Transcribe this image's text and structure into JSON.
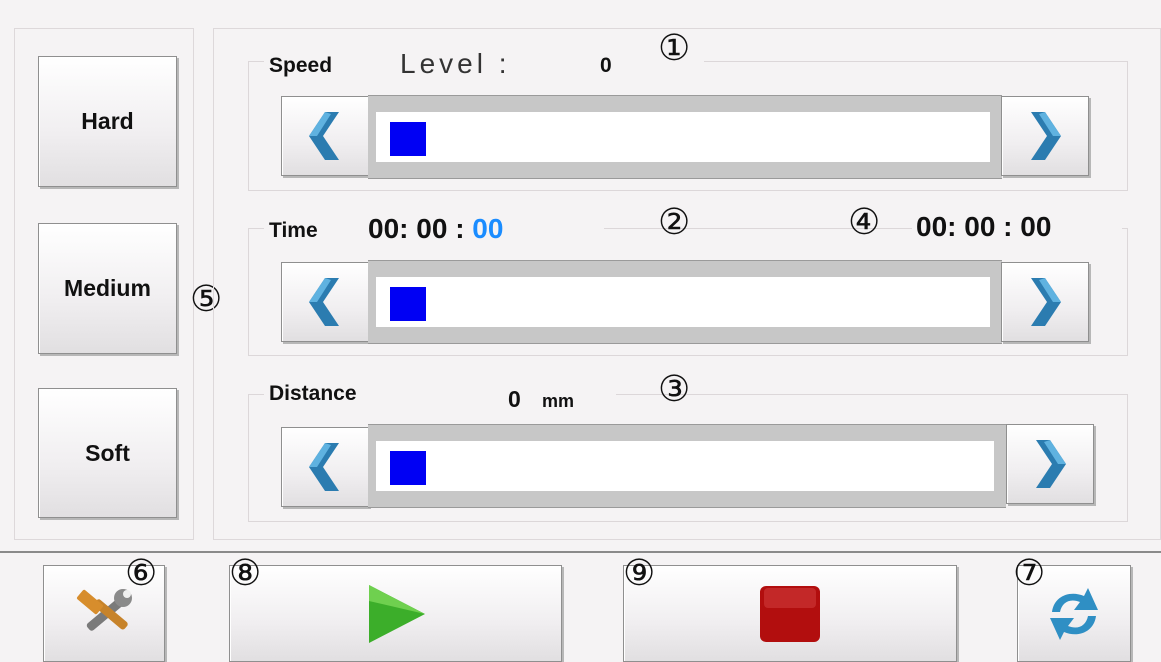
{
  "modes": {
    "hard": "Hard",
    "medium": "Medium",
    "soft": "Soft"
  },
  "speed": {
    "label": "Speed",
    "level_label": "Level :",
    "level_value": "0",
    "marker": "①",
    "fill_fraction": 0
  },
  "time": {
    "label": "Time",
    "hours": "00:",
    "minutes": "00",
    "sep": ":",
    "seconds": "00",
    "marker": "②",
    "total_marker": "④",
    "total": "00: 00 : 00",
    "fill_fraction": 0
  },
  "distance": {
    "label": "Distance",
    "value": "0",
    "unit": "mm",
    "marker": "③",
    "fill_fraction": 0
  },
  "markers": {
    "modes": "⑤",
    "settings": "⑥",
    "refresh": "⑦",
    "play": "⑧",
    "stop": "⑨"
  },
  "colors": {
    "thumb": "#0000f4",
    "seconds": "#1a8cff",
    "play": "#3cae2a",
    "stop": "#b20e0e"
  },
  "icons": {
    "decrease": "chevron-left-icon",
    "increase": "chevron-right-icon",
    "settings": "tools-icon",
    "play": "play-icon",
    "stop": "stop-icon",
    "refresh": "refresh-icon"
  }
}
